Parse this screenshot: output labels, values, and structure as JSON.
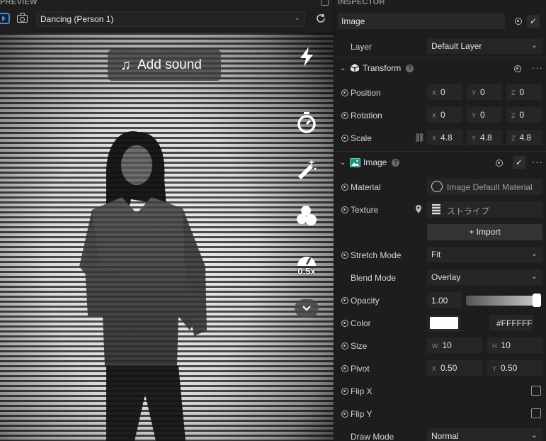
{
  "preview": {
    "title": "PREVIEW",
    "selected_preview": "Dancing (Person 1)",
    "add_sound": "Add sound",
    "speed": "0.5x",
    "icons": [
      "popout-icon",
      "video-icon",
      "camera-icon",
      "refresh-icon",
      "music-note-icon",
      "flash-icon",
      "timer-icon",
      "magic-wand-icon",
      "effects-icon",
      "speed-icon",
      "chevron-down-icon"
    ]
  },
  "inspector": {
    "title": "INSPECTOR",
    "object_name": "Image",
    "layer": {
      "label": "Layer",
      "value": "Default Layer"
    },
    "transform": {
      "header": "Transform",
      "position": {
        "label": "Position",
        "x": "0",
        "y": "0",
        "z": "0"
      },
      "rotation": {
        "label": "Rotation",
        "x": "0",
        "y": "0",
        "z": "0"
      },
      "scale": {
        "label": "Scale",
        "x": "4.8",
        "y": "4.8",
        "z": "4.8"
      }
    },
    "image": {
      "header": "Image",
      "material": {
        "label": "Material",
        "value": "Image Default Material"
      },
      "texture": {
        "label": "Texture",
        "value": "ストライプ"
      },
      "import_label": "+ Import",
      "stretch_mode": {
        "label": "Stretch Mode",
        "value": "Fit"
      },
      "blend_mode": {
        "label": "Blend Mode",
        "value": "Overlay"
      },
      "opacity": {
        "label": "Opacity",
        "value": "1.00",
        "level": 1.0
      },
      "color": {
        "label": "Color",
        "value": "#FFFFFF"
      },
      "size": {
        "label": "Size",
        "w": "10",
        "h": "10"
      },
      "pivot": {
        "label": "Pivot",
        "x": "0.50",
        "y": "0.50"
      },
      "flip_x": {
        "label": "Flip X",
        "checked": false
      },
      "flip_y": {
        "label": "Flip Y",
        "checked": false
      },
      "draw_mode": {
        "label": "Draw Mode",
        "value": "Normal"
      }
    },
    "axes": {
      "x": "X",
      "y": "Y",
      "z": "Z",
      "w": "W",
      "h": "H"
    },
    "help": "?"
  },
  "colors": {
    "accent": "#3d8ef0",
    "panel": "#1d1d1d",
    "field": "#262626"
  }
}
